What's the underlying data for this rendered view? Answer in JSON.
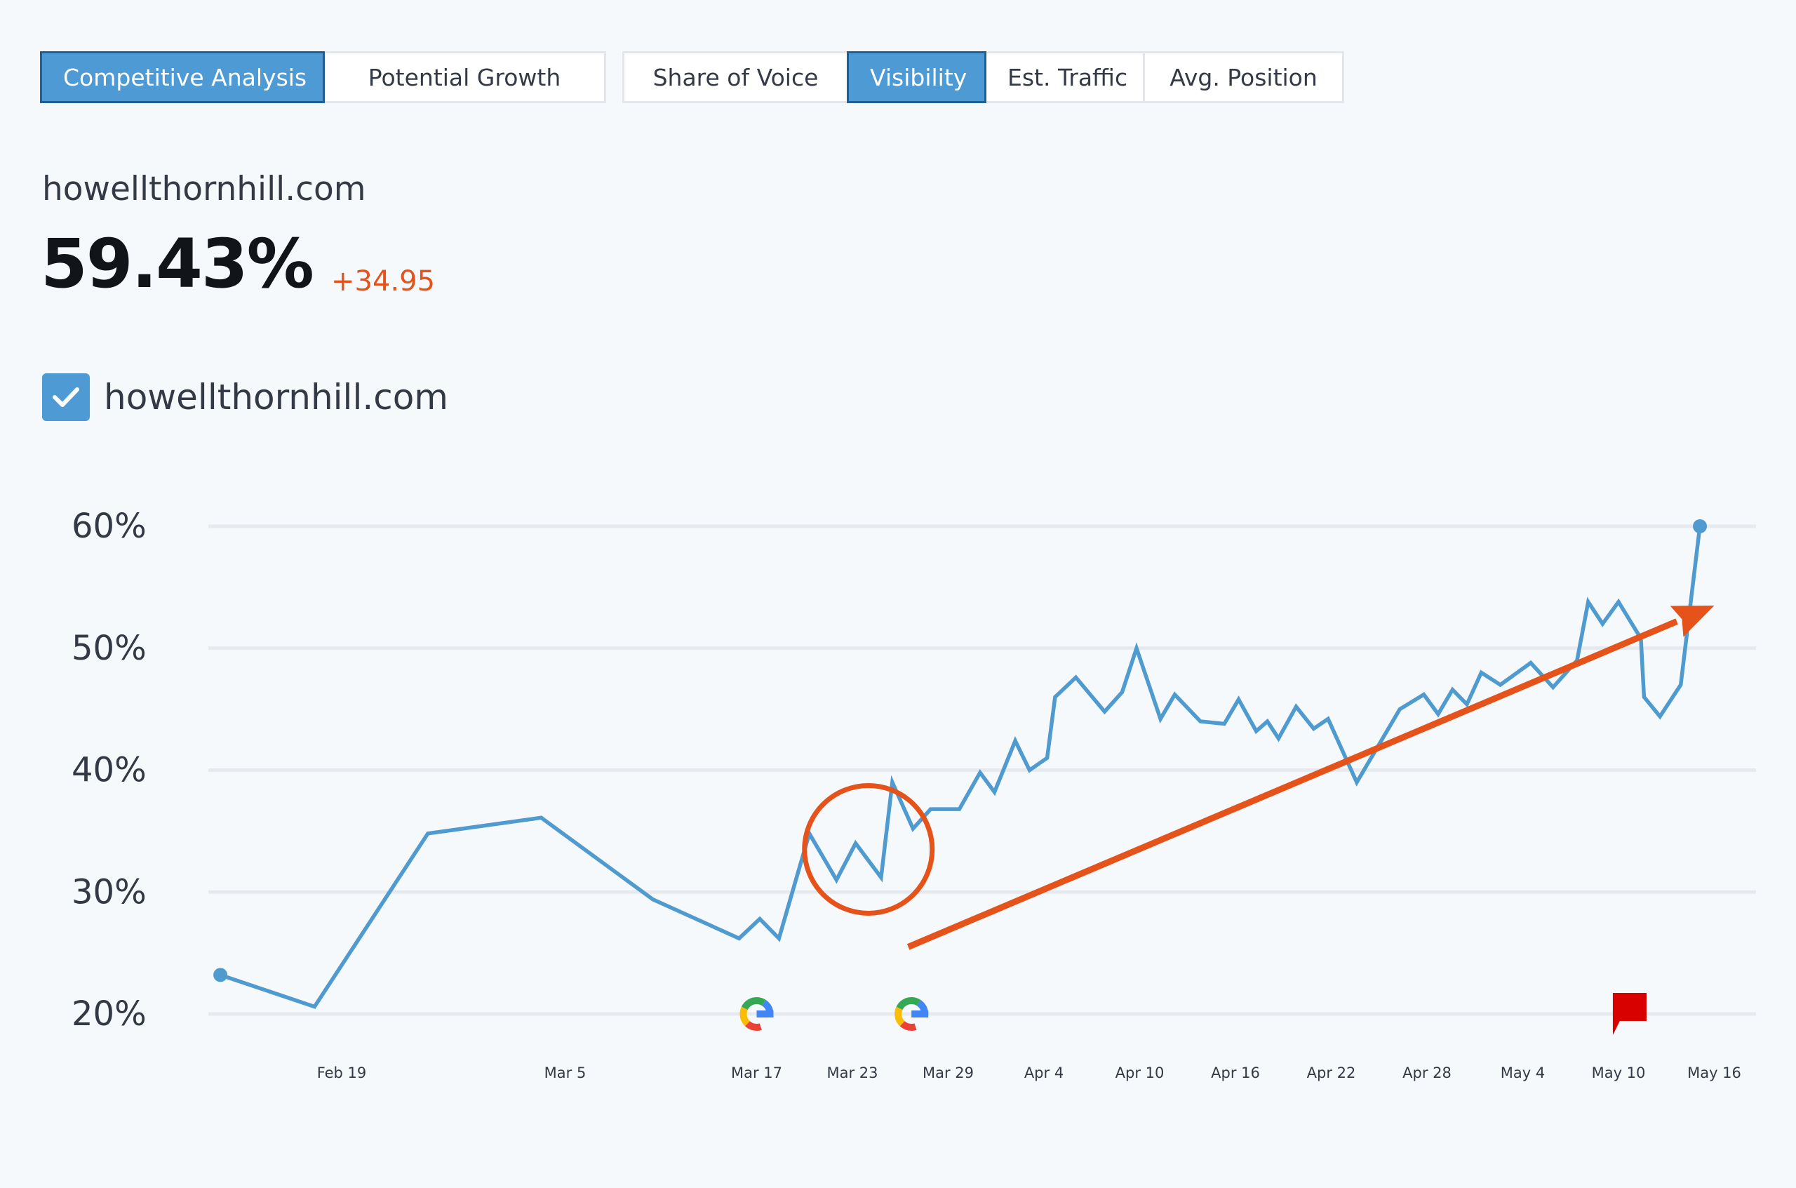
{
  "tabs_left": [
    {
      "label": "Competitive Analysis",
      "active": true
    },
    {
      "label": "Potential Growth",
      "active": false
    }
  ],
  "tabs_right": [
    {
      "label": "Share of Voice",
      "active": false
    },
    {
      "label": "Visibility",
      "active": true
    },
    {
      "label": "Est. Traffic",
      "active": false
    },
    {
      "label": "Avg. Position",
      "active": false
    }
  ],
  "summary": {
    "domain": "howellthornhill.com",
    "value": "59.43%",
    "delta": "+34.95"
  },
  "legend": {
    "label": "howellthornhill.com",
    "checked": true
  },
  "colors": {
    "accent": "#4d9ad5",
    "line": "#4f9bd0",
    "annotation": "#e5531b",
    "delta": "#e5531b",
    "flag": "#d90000"
  },
  "chart_data": {
    "type": "line",
    "title": "",
    "xlabel": "",
    "ylabel": "",
    "ylim": [
      20,
      60
    ],
    "y_ticks": [
      60,
      50,
      40,
      30,
      20
    ],
    "y_tick_labels": [
      "60%",
      "50%",
      "40%",
      "30%",
      "20%"
    ],
    "x_ticks": [
      {
        "label": "Feb 19",
        "day": 0
      },
      {
        "label": "Mar 5",
        "day": 14
      },
      {
        "label": "Mar 17",
        "day": 26
      },
      {
        "label": "Mar 23",
        "day": 32
      },
      {
        "label": "Mar 29",
        "day": 38
      },
      {
        "label": "Apr 4",
        "day": 44
      },
      {
        "label": "Apr 10",
        "day": 50
      },
      {
        "label": "Apr 16",
        "day": 56
      },
      {
        "label": "Apr 22",
        "day": 62
      },
      {
        "label": "Apr 28",
        "day": 68
      },
      {
        "label": "May 4",
        "day": 74
      },
      {
        "label": "May 10",
        "day": 80
      },
      {
        "label": "May 16",
        "day": 86
      }
    ],
    "grid": true,
    "series": [
      {
        "values": [
          [
            -7.6,
            23.2
          ],
          [
            -1.7,
            20.6
          ],
          [
            5.4,
            34.8
          ],
          [
            12.5,
            36.1
          ],
          [
            19.5,
            29.4
          ],
          [
            24.9,
            26.2
          ],
          [
            26.2,
            27.8
          ],
          [
            27.4,
            26.2
          ],
          [
            29.3,
            34.8
          ],
          [
            31.0,
            31.0
          ],
          [
            32.2,
            34.0
          ],
          [
            33.8,
            31.2
          ],
          [
            34.5,
            39.0
          ],
          [
            35.8,
            35.2
          ],
          [
            36.9,
            36.8
          ],
          [
            38.7,
            36.8
          ],
          [
            40.0,
            39.8
          ],
          [
            40.9,
            38.2
          ],
          [
            42.2,
            42.4
          ],
          [
            43.1,
            40.0
          ],
          [
            44.2,
            41.0
          ],
          [
            44.7,
            46.0
          ],
          [
            46.0,
            47.6
          ],
          [
            47.8,
            44.8
          ],
          [
            48.9,
            46.4
          ],
          [
            49.8,
            50.0
          ],
          [
            51.3,
            44.2
          ],
          [
            52.2,
            46.2
          ],
          [
            53.8,
            44.0
          ],
          [
            55.3,
            43.8
          ],
          [
            56.2,
            45.8
          ],
          [
            57.3,
            43.2
          ],
          [
            58.0,
            44.0
          ],
          [
            58.7,
            42.6
          ],
          [
            59.8,
            45.2
          ],
          [
            60.9,
            43.4
          ],
          [
            61.8,
            44.2
          ],
          [
            63.6,
            39.0
          ],
          [
            66.3,
            45.0
          ],
          [
            67.8,
            46.2
          ],
          [
            68.7,
            44.6
          ],
          [
            69.6,
            46.6
          ],
          [
            70.5,
            45.4
          ],
          [
            71.4,
            48.0
          ],
          [
            72.6,
            47.0
          ],
          [
            74.5,
            48.8
          ],
          [
            75.9,
            46.8
          ],
          [
            77.4,
            49.0
          ],
          [
            78.1,
            53.8
          ],
          [
            79.0,
            52.0
          ],
          [
            80.0,
            53.8
          ],
          [
            81.4,
            50.8
          ],
          [
            81.6,
            46.0
          ],
          [
            82.6,
            44.4
          ],
          [
            83.9,
            47.0
          ],
          [
            85.1,
            60.0
          ]
        ]
      }
    ],
    "event_markers": [
      {
        "type": "google-update",
        "day": 26.0
      },
      {
        "type": "google-update",
        "day": 35.7
      },
      {
        "type": "flag",
        "day": 80.7
      }
    ],
    "annotations": [
      {
        "type": "circle",
        "center": [
          33.0,
          33.5
        ],
        "radius_days": 4.0
      },
      {
        "type": "arrow",
        "from": [
          35.5,
          25.5
        ],
        "to": [
          86.0,
          53.5
        ]
      }
    ]
  }
}
